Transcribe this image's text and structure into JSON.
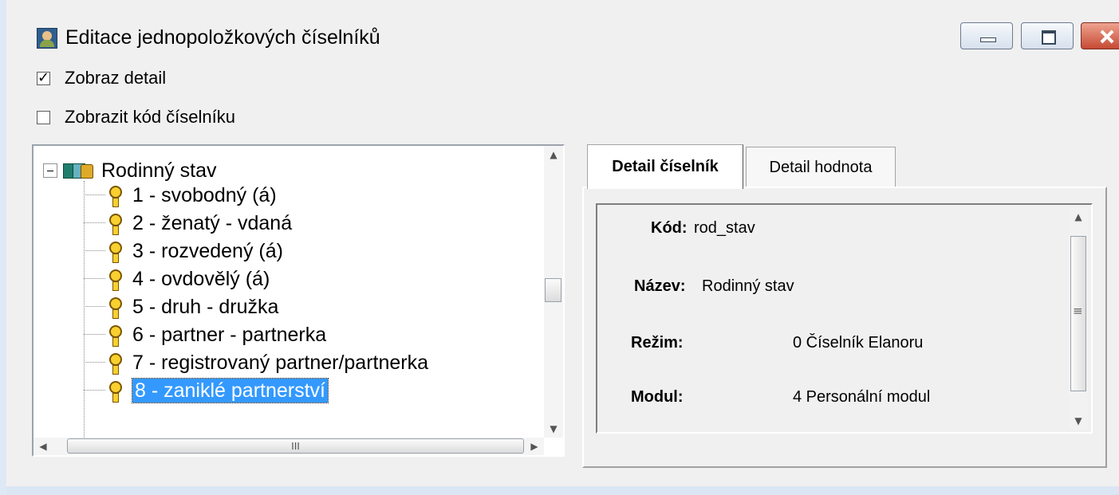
{
  "window": {
    "title": "Editace jednopoložkových číselníků",
    "icons": {
      "app": "person-icon",
      "minimize": "minimize-icon",
      "maximize": "maximize-icon",
      "close": "close-icon"
    }
  },
  "options": {
    "show_detail": {
      "label": "Zobraz detail",
      "checked": true
    },
    "show_code": {
      "label": "Zobrazit kód číselníku",
      "checked": false
    }
  },
  "tree": {
    "root": {
      "label": "Rodinný stav",
      "icon": "codebook-icon",
      "expanded": true
    },
    "items": [
      {
        "label": "1 - svobodný (á)",
        "icon": "key-icon",
        "selected": false
      },
      {
        "label": "2 - ženatý - vdaná",
        "icon": "key-icon",
        "selected": false
      },
      {
        "label": "3 - rozvedený (á)",
        "icon": "key-icon",
        "selected": false
      },
      {
        "label": "4 - ovdovělý (á)",
        "icon": "key-icon",
        "selected": false
      },
      {
        "label": "5 - druh - družka",
        "icon": "key-icon",
        "selected": false
      },
      {
        "label": "6 - partner - partnerka",
        "icon": "key-icon",
        "selected": false
      },
      {
        "label": "7 - registrovaný partner/partnerka",
        "icon": "key-icon",
        "selected": false
      },
      {
        "label": "8 - zaniklé partnerství",
        "icon": "key-icon",
        "selected": true
      }
    ],
    "vertical_scroll_position": 0.53,
    "horizontal_scroll_marker": "III"
  },
  "tabs": [
    {
      "label": "Detail číselník",
      "active": true
    },
    {
      "label": "Detail hodnota",
      "active": false
    }
  ],
  "detail": {
    "code": {
      "label": "Kód:",
      "value": "rod_stav"
    },
    "name": {
      "label": "Název:",
      "value": "Rodinný stav"
    },
    "mode": {
      "label": "Režim:",
      "value": "0 Číselník Elanoru"
    },
    "module": {
      "label": "Modul:",
      "value": "4 Personální modul"
    }
  },
  "colors": {
    "selection": "#3399ff",
    "window_background": "#f0f0f0",
    "close_button": "#c64a34"
  }
}
